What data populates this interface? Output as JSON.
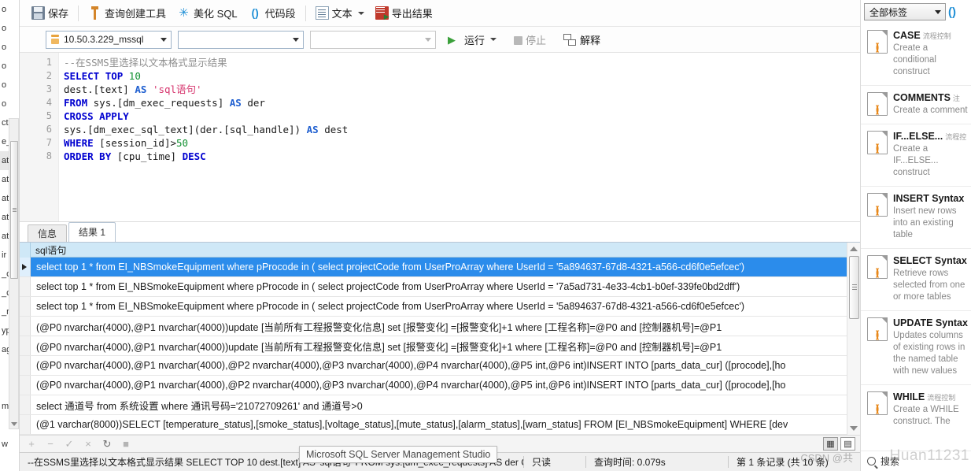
{
  "toolbar": {
    "save": "保存",
    "query_builder": "查询创建工具",
    "beautify_sql": "美化 SQL",
    "code_snippet": "代码段",
    "text": "文本",
    "export_result": "导出结果"
  },
  "connection": {
    "server": "10.50.3.229_mssql",
    "database": "",
    "table": "",
    "run": "运行",
    "stop": "停止",
    "explain": "解释"
  },
  "editor": {
    "line_numbers": [
      "1",
      "2",
      "3",
      "4",
      "5",
      "6",
      "7",
      "8"
    ],
    "lines": [
      "--在SSMS里选择以文本格式显示结果",
      "SELECT TOP 10",
      "dest.[text] AS 'sql语句'",
      "FROM sys.[dm_exec_requests] AS der",
      "CROSS APPLY",
      "sys.[dm_exec_sql_text](der.[sql_handle]) AS dest",
      "WHERE [session_id]>50",
      "ORDER BY [cpu_time] DESC"
    ]
  },
  "results": {
    "tabs": [
      {
        "label": "信息",
        "active": false
      },
      {
        "label": "结果 1",
        "active": true
      }
    ],
    "column_header": "sql语句",
    "rows": [
      {
        "selected": true,
        "text": "select top 1 * from EI_NBSmokeEquipment where  pProcode in ( select projectCode from  UserProArray where UserId = '5a894637-67d8-4321-a566-cd6f0e5efcec')"
      },
      {
        "selected": false,
        "text": "select top 1 * from EI_NBSmokeEquipment where  pProcode in ( select projectCode from  UserProArray where UserId = '7a5ad731-4e33-4cb1-b0ef-339fe0bd2dff')"
      },
      {
        "selected": false,
        "text": "select top 1 * from EI_NBSmokeEquipment where  pProcode in ( select projectCode from  UserProArray where UserId = '5a894637-67d8-4321-a566-cd6f0e5efcec')"
      },
      {
        "selected": false,
        "text": "(@P0 nvarchar(4000),@P1 nvarchar(4000))update [当前所有工程报警变化信息] set [报警变化] =[报警变化]+1 where [工程名称]=@P0 and [控制器机号]=@P1"
      },
      {
        "selected": false,
        "text": "(@P0 nvarchar(4000),@P1 nvarchar(4000))update [当前所有工程报警变化信息] set [报警变化] =[报警变化]+1 where [工程名称]=@P0 and [控制器机号]=@P1"
      },
      {
        "selected": false,
        "text": "(@P0 nvarchar(4000),@P1 nvarchar(4000),@P2 nvarchar(4000),@P3 nvarchar(4000),@P4 nvarchar(4000),@P5 int,@P6 int)INSERT  INTO [parts_data_cur]  ([procode],[ho"
      },
      {
        "selected": false,
        "text": "(@P0 nvarchar(4000),@P1 nvarchar(4000),@P2 nvarchar(4000),@P3 nvarchar(4000),@P4 nvarchar(4000),@P5 int,@P6 int)INSERT  INTO [parts_data_cur]  ([procode],[ho"
      },
      {
        "selected": false,
        "text": "select 通道号 from 系统设置 where 通讯号码='21072709261' and 通道号>0"
      },
      {
        "selected": false,
        "text": "(@1 varchar(8000))SELECT [temperature_status],[smoke_status],[voltage_status],[mute_status],[alarm_status],[warn_status] FROM [EI_NBSmokeEquipment] WHERE [dev"
      }
    ],
    "footer_icons": [
      "+",
      "−",
      "✓",
      "×",
      "↻",
      "■"
    ],
    "search_label": "搜索"
  },
  "statusbar": {
    "sql_text": "--在SSMS里选择以文本格式显示结果 SELECT TOP 10  dest.[text] AS 'sql语句' FROM sys.[dm_exec_requests] AS der  CROSS APPLY",
    "readonly": "只读",
    "query_time": "查询时间: 0.079s",
    "record_info": "第 1 条记录 (共 10 条)"
  },
  "tooltip": {
    "text": "Microsoft SQL Server Management Studio"
  },
  "snippets": {
    "filter_label": "全部标签",
    "items": [
      {
        "title": "CASE",
        "tag": "流程控制",
        "desc": "Create a conditional construct"
      },
      {
        "title": "COMMENTS",
        "tag": "注",
        "desc": "Create a comment"
      },
      {
        "title": "IF...ELSE...",
        "tag": "流程控",
        "desc": "Create a IF...ELSE... construct"
      },
      {
        "title": "INSERT Syntax",
        "tag": "",
        "desc": "Insert new rows into an existing table"
      },
      {
        "title": "SELECT Syntax",
        "tag": "",
        "desc": "Retrieve rows selected from one or more tables"
      },
      {
        "title": "UPDATE Syntax",
        "tag": "",
        "desc": "Updates columns of existing rows in the named table with new values"
      },
      {
        "title": "WHILE",
        "tag": "流程控制",
        "desc": "Create a WHILE construct. The"
      }
    ]
  },
  "left_strip": {
    "rows": [
      "o",
      "o",
      "o",
      "o",
      "o",
      "o",
      "cti",
      "e_",
      "at",
      "at",
      "at",
      "at",
      "at",
      "ir",
      "_c",
      "_c",
      "_r",
      "yp",
      "ag",
      "",
      "",
      "m",
      "",
      "w"
    ]
  },
  "watermark": {
    "text": "Huan11231",
    "text2": "CSDN @共"
  }
}
